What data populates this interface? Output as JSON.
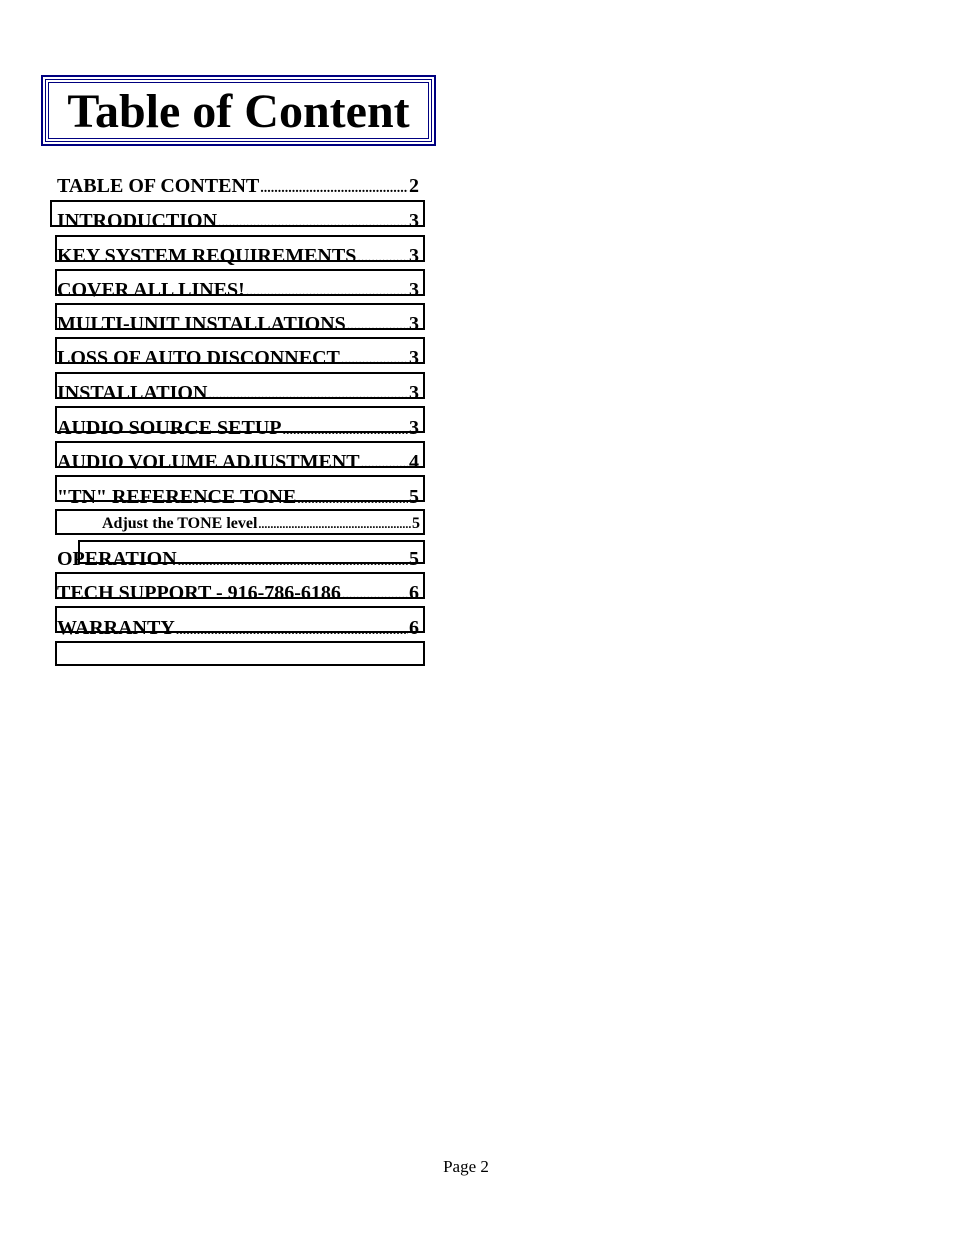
{
  "title": "Table of Content",
  "colors": {
    "title_border": "#000080",
    "text": "#000000",
    "link_box": "#000000"
  },
  "toc": [
    {
      "label": "TABLE OF CONTENT",
      "page": "2",
      "level": 1
    },
    {
      "label": "INTRODUCTION",
      "page": "3",
      "level": 1
    },
    {
      "label": "KEY SYSTEM REQUIREMENTS",
      "page": "3",
      "level": 1
    },
    {
      "label": "COVER ALL LINES!",
      "page": "3",
      "level": 1
    },
    {
      "label": "MULTI-UNIT INSTALLATIONS",
      "page": "3",
      "level": 1
    },
    {
      "label": "LOSS OF AUTO DISCONNECT",
      "page": "3",
      "level": 1
    },
    {
      "label": "INSTALLATION",
      "page": "3",
      "level": 1
    },
    {
      "label": "AUDIO SOURCE SETUP",
      "page": "3",
      "level": 1
    },
    {
      "label": "AUDIO VOLUME ADJUSTMENT",
      "page": "4",
      "level": 1
    },
    {
      "label": "\"TN\" REFERENCE TONE",
      "page": "5",
      "level": 1
    },
    {
      "label": "Adjust the TONE level",
      "page": "5",
      "level": 2
    },
    {
      "label": "OPERATION",
      "page": "5",
      "level": 1
    },
    {
      "label": "TECH SUPPORT - 916-786-6186",
      "page": "6",
      "level": 1
    },
    {
      "label": "WARRANTY",
      "page": "6",
      "level": 1
    }
  ],
  "footer": {
    "page_label": "Page 2"
  }
}
